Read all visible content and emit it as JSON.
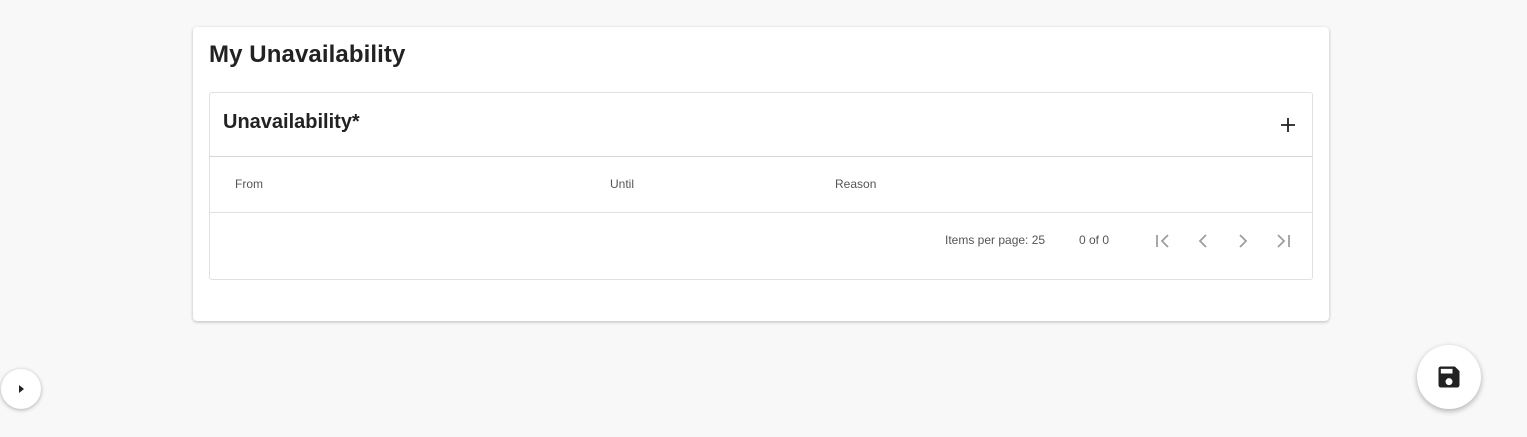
{
  "page": {
    "title": "My Unavailability"
  },
  "section": {
    "title": "Unavailability*",
    "add_icon": "plus-icon"
  },
  "table": {
    "columns": [
      "From",
      "Until",
      "Reason"
    ],
    "rows": []
  },
  "paginator": {
    "items_per_page_label": "Items per page: 25",
    "range_label": "0 of 0",
    "icons": [
      "first-page-icon",
      "chevron-left-icon",
      "chevron-right-icon",
      "last-page-icon"
    ]
  },
  "floating": {
    "sidebar_toggle_icon": "caret-right-icon",
    "save_icon": "floppy-disk-icon"
  },
  "colors": {
    "background": "#f8f8f8",
    "card": "#ffffff",
    "text": "#222222"
  }
}
